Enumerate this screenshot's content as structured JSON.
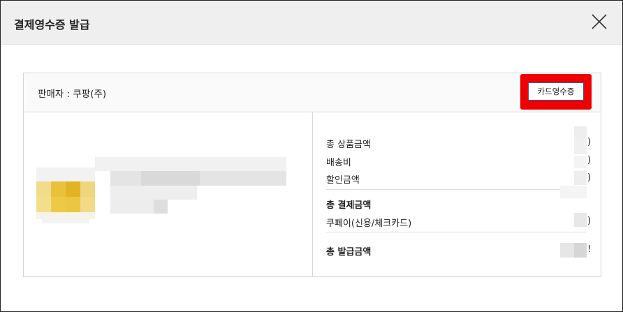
{
  "modal": {
    "title": "결제영수증 발급",
    "close_icon": "close-icon"
  },
  "seller": {
    "label": "판매자 : 쿠팡(주)",
    "card_receipt_button": "카드영수증",
    "highlight_color": "#ee0000"
  },
  "amounts": {
    "total_product_label": "총 상품금액",
    "shipping_label": "배송비",
    "discount_label": "할인금액",
    "total_payment_label": "총 결제금액",
    "payment_method_label": "쿠페이(신용/체크카드)",
    "total_issued_label": "총 발급금액",
    "total_product_tail": ")",
    "shipping_tail": ")",
    "discount_tail": ")",
    "payment_method_tail": ")",
    "total_issued_tail": "!"
  }
}
